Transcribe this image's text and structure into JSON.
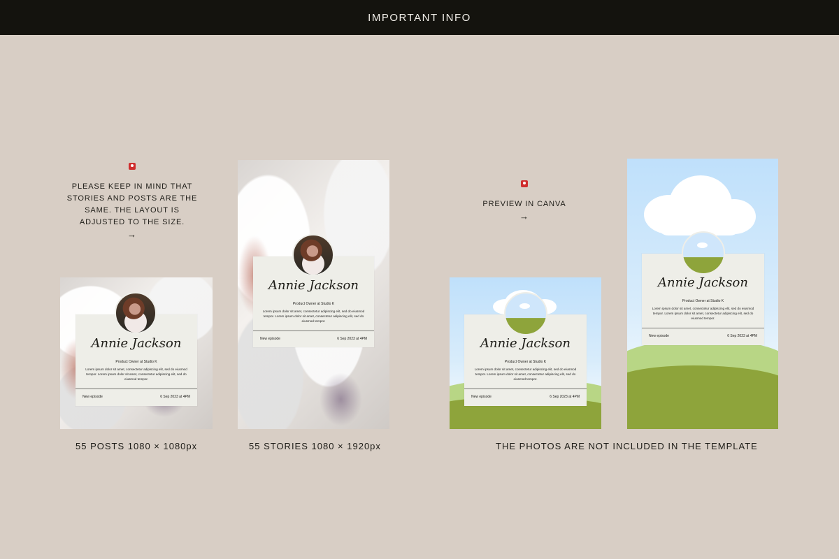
{
  "header": {
    "title": "IMPORTANT INFO"
  },
  "notes": {
    "left": {
      "icon": "pin-icon",
      "lines": [
        "PLEASE KEEP IN MIND THAT",
        "STORIES AND POSTS ARE THE",
        "SAME. THE LAYOUT IS",
        "ADJUSTED TO THE SIZE."
      ],
      "arrow": "→"
    },
    "right": {
      "icon": "pin-icon",
      "label": "PREVIEW IN CANVA",
      "arrow": "→"
    }
  },
  "captions": {
    "posts": "55 POSTS 1080 × 1080px",
    "stories": "55 STORIES 1080 × 1920px",
    "photos_note": "THE PHOTOS ARE NOT INCLUDED IN THE TEMPLATE"
  },
  "mockups": {
    "name": "Annie Jackson",
    "role": "Product Owner at Studio K",
    "body": "Lorem ipsum dolor sit amet, consectetur adipiscing elit, sed do eiusmod tempor. Lorem ipsum dolor sit amet, consectetur adipiscing elit, sed do eiusmod tempor.",
    "footer_left": "New episode",
    "footer_right": "6 Sep 2023 at 4PM"
  },
  "colors": {
    "background": "#d8cec5",
    "header": "#14130e",
    "card": "#eeeee8",
    "green_dark": "#8ea43b",
    "green_light": "#b8d685",
    "sky": "#bfe0fb"
  }
}
